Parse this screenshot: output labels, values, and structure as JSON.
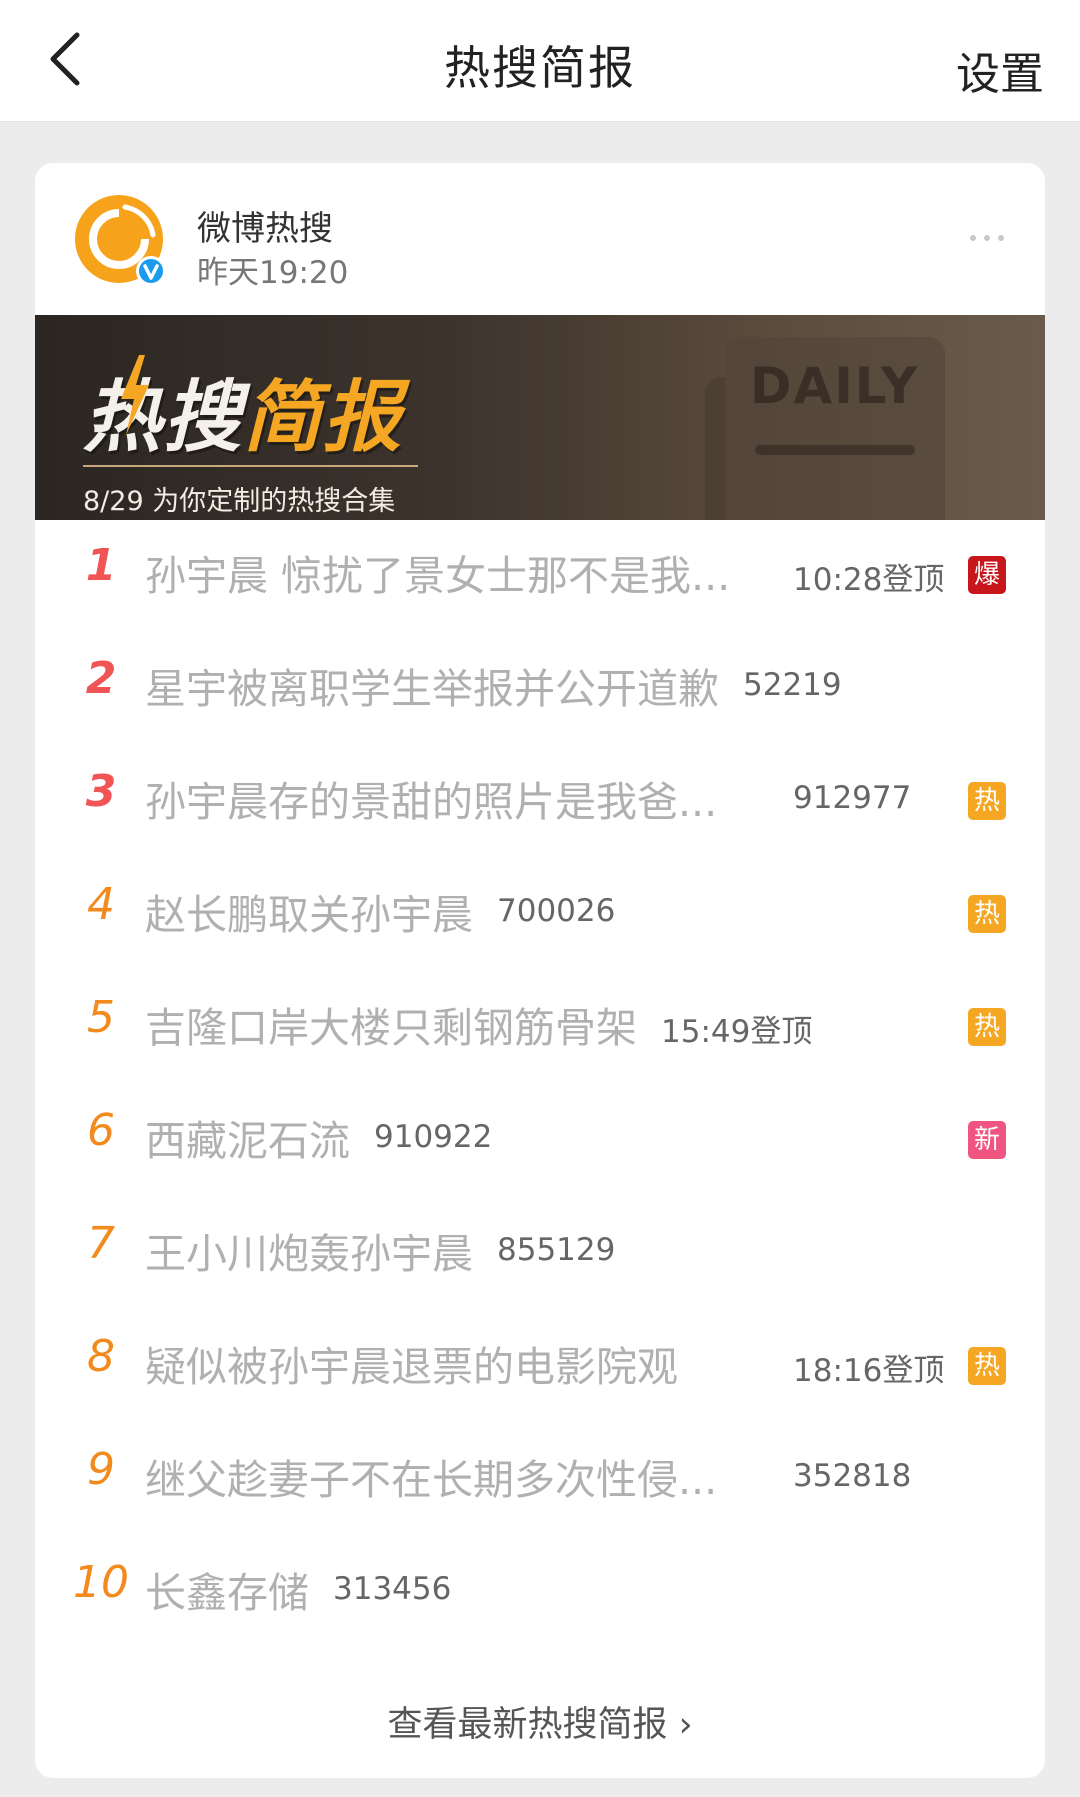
{
  "header": {
    "title": "热搜简报",
    "settings_label": "设置",
    "back_icon": "chevron-left-icon"
  },
  "post": {
    "author": "微博热搜",
    "time": "昨天19:20",
    "more_icon": "more-dots-icon"
  },
  "banner": {
    "title_part1": "热搜",
    "title_part2": "简报",
    "subtitle": "8/29 为你定制的热搜合集",
    "daily_label": "DAILY"
  },
  "hot_items": [
    {
      "rank": "1",
      "title": "孙宇晨 惊扰了景女士那不是我...",
      "meta": "10:28登顶",
      "badge": "爆",
      "badge_color": "#c8161d"
    },
    {
      "rank": "2",
      "title": "星宇被离职学生举报并公开道歉",
      "meta": "52219",
      "badge": "",
      "badge_color": ""
    },
    {
      "rank": "3",
      "title": "孙宇晨存的景甜的照片是我爸...",
      "meta": "912977",
      "badge": "热",
      "badge_color": "#f5a623"
    },
    {
      "rank": "4",
      "title": "赵长鹏取关孙宇晨",
      "meta": "700026",
      "badge": "热",
      "badge_color": "#f5a623"
    },
    {
      "rank": "5",
      "title": "吉隆口岸大楼只剩钢筋骨架",
      "meta": "15:49登顶",
      "badge": "热",
      "badge_color": "#f5a623"
    },
    {
      "rank": "6",
      "title": "西藏泥石流",
      "meta": "910922",
      "badge": "新",
      "badge_color": "#f0557f"
    },
    {
      "rank": "7",
      "title": "王小川炮轰孙宇晨",
      "meta": "855129",
      "badge": "",
      "badge_color": ""
    },
    {
      "rank": "8",
      "title": "疑似被孙宇晨退票的电影院观",
      "meta": "18:16登顶",
      "badge": "热",
      "badge_color": "#f5a623"
    },
    {
      "rank": "9",
      "title": "继父趁妻子不在长期多次性侵...",
      "meta": "352818",
      "badge": "",
      "badge_color": ""
    },
    {
      "rank": "10",
      "title": "长鑫存储",
      "meta": "313456",
      "badge": "",
      "badge_color": ""
    }
  ],
  "footer": {
    "view_latest": "查看最新热搜简报 ›"
  },
  "colors": {
    "rank_top": "#f05454",
    "rank_rest": "#f28a1e",
    "avatar_orange": "#f7a21b",
    "verified_blue": "#1b9bf0"
  }
}
